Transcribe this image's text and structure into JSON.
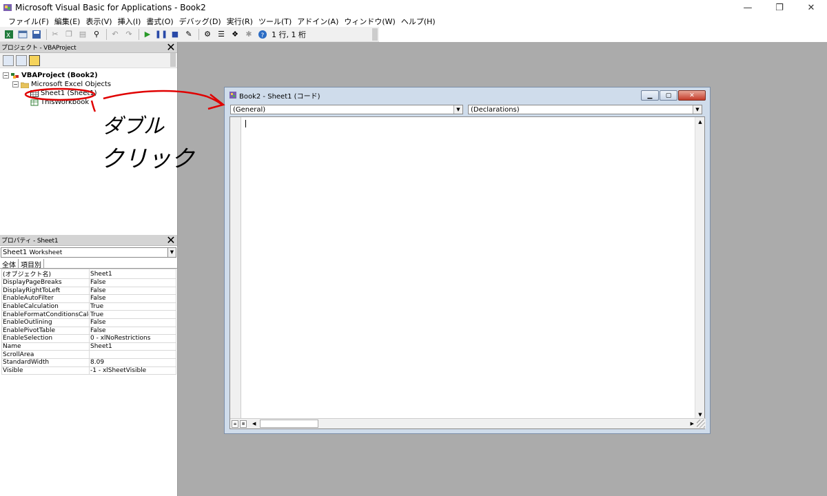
{
  "window": {
    "title": "Microsoft Visual Basic for Applications - Book2",
    "minimize_glyph": "—",
    "restore_glyph": "❐",
    "close_glyph": "✕"
  },
  "menu": [
    "ファイル(F)",
    "編集(E)",
    "表示(V)",
    "挿入(I)",
    "書式(O)",
    "デバッグ(D)",
    "実行(R)",
    "ツール(T)",
    "アドイン(A)",
    "ウィンドウ(W)",
    "ヘルプ(H)"
  ],
  "toolbar": {
    "position_text": "1 行, 1 桁",
    "icons": [
      "excel-icon",
      "insert-userform-icon",
      "save-icon",
      "cut-icon",
      "copy-icon",
      "paste-icon",
      "find-icon",
      "undo-icon",
      "redo-icon",
      "run-icon",
      "break-icon",
      "reset-icon",
      "design-mode-icon",
      "project-explorer-icon",
      "properties-window-icon",
      "object-browser-icon",
      "toolbox-icon",
      "help-icon"
    ]
  },
  "project_pane": {
    "title": "プロジェクト - VBAProject",
    "tree": {
      "root": "VBAProject (Book2)",
      "folder": "Microsoft Excel Objects",
      "items": [
        "Sheet1 (Sheet1)",
        "ThisWorkbook"
      ]
    }
  },
  "properties_pane": {
    "title": "プロパティ - Sheet1",
    "object_name": "Sheet1",
    "object_type": "Worksheet",
    "tabs": [
      "全体",
      "項目別"
    ],
    "rows": [
      {
        "key": "(オブジェクト名)",
        "value": "Sheet1"
      },
      {
        "key": "DisplayPageBreaks",
        "value": "False"
      },
      {
        "key": "DisplayRightToLeft",
        "value": "False"
      },
      {
        "key": "EnableAutoFilter",
        "value": "False"
      },
      {
        "key": "EnableCalculation",
        "value": "True"
      },
      {
        "key": "EnableFormatConditionsCalcu",
        "value": "True"
      },
      {
        "key": "EnableOutlining",
        "value": "False"
      },
      {
        "key": "EnablePivotTable",
        "value": "False"
      },
      {
        "key": "EnableSelection",
        "value": "0 - xlNoRestrictions"
      },
      {
        "key": "Name",
        "value": "Sheet1"
      },
      {
        "key": "ScrollArea",
        "value": ""
      },
      {
        "key": "StandardWidth",
        "value": "8.09"
      },
      {
        "key": "Visible",
        "value": "-1 - xlSheetVisible"
      }
    ]
  },
  "code_window": {
    "title": "Book2 - Sheet1 (コード)",
    "object_combo": "(General)",
    "procedure_combo": "(Declarations)"
  },
  "annotation": {
    "line1": "ダブル",
    "line2": "クリック",
    "color": "#e00000"
  }
}
